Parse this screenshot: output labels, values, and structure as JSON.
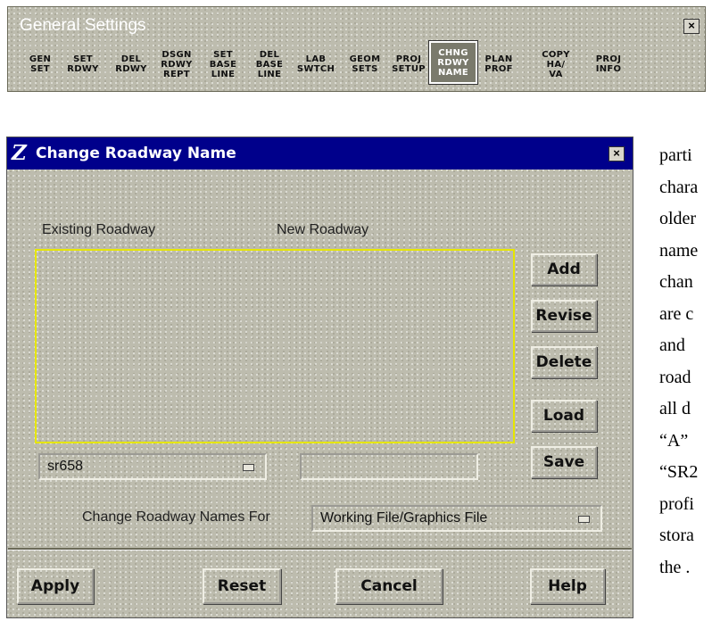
{
  "general_settings": {
    "title": "General Settings",
    "close_label": "×",
    "tools": [
      {
        "label": "GEN\nSET",
        "active": false
      },
      {
        "label": "SET\nRDWY",
        "active": false
      },
      {
        "label": "DEL\nRDWY",
        "active": false
      },
      {
        "label": "DSGN\nRDWY\nREPT",
        "active": false
      },
      {
        "label": "SET\nBASE\nLINE",
        "active": false
      },
      {
        "label": "DEL\nBASE\nLINE",
        "active": false
      },
      {
        "label": "LAB\nSWTCH",
        "active": false
      },
      {
        "label": "GEOM\nSETS",
        "active": false
      },
      {
        "label": "PROJ\nSETUP",
        "active": false
      },
      {
        "label": "CHNG\nRDWY\nNAME",
        "active": true
      },
      {
        "label": "PLAN\nPROF",
        "active": false
      },
      {
        "label": "COPY\nHA/\nVA",
        "active": false
      },
      {
        "label": "PROJ\nINFO",
        "active": false
      }
    ]
  },
  "dialog": {
    "title": "Change Roadway Name",
    "logo_glyph": "Z",
    "close_label": "×",
    "existing_label": "Existing Roadway",
    "new_label": "New Roadway",
    "existing_value": "sr658",
    "new_value": "",
    "side_buttons": {
      "add": "Add",
      "revise": "Revise",
      "delete": "Delete",
      "load": "Load",
      "save": "Save"
    },
    "change_for_label": "Change Roadway Names For",
    "change_for_value": "Working File/Graphics File",
    "bottom_buttons": {
      "apply": "Apply",
      "reset": "Reset",
      "cancel": "Cancel",
      "help": "Help"
    }
  },
  "document_lines": [
    "parti",
    "chara",
    "older",
    "name",
    "chan",
    "are c",
    "and",
    "road",
    "all d",
    "“A”",
    "“SR2",
    "profi",
    "stora",
    "the ."
  ]
}
